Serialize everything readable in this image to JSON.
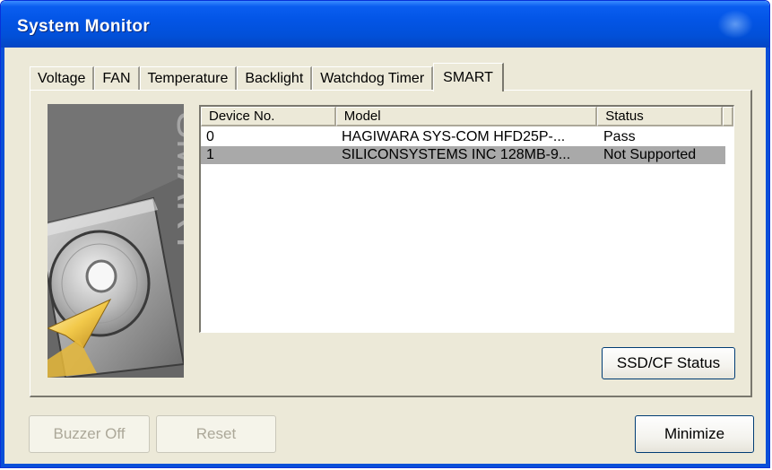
{
  "window": {
    "title": "System Monitor"
  },
  "tabs": [
    {
      "label": "Voltage",
      "active": false
    },
    {
      "label": "FAN",
      "active": false
    },
    {
      "label": "Temperature",
      "active": false
    },
    {
      "label": "Backlight",
      "active": false
    },
    {
      "label": "Watchdog Timer",
      "active": false
    },
    {
      "label": "SMART",
      "active": true
    }
  ],
  "smart_panel": {
    "image_text": "SMART",
    "columns": [
      "Device No.",
      "Model",
      "Status"
    ],
    "rows": [
      {
        "device_no": "0",
        "model": "HAGIWARA SYS-COM HFD25P-...",
        "status": "Pass",
        "selected": false
      },
      {
        "device_no": "1",
        "model": "SILICONSYSTEMS INC 128MB-9...",
        "status": "Not Supported",
        "selected": true
      }
    ],
    "ssd_cf_status_label": "SSD/CF Status"
  },
  "footer": {
    "buzzer_off_label": "Buzzer Off",
    "reset_label": "Reset",
    "minimize_label": "Minimize"
  },
  "colors": {
    "title_bar": "#0355e6",
    "selected_row": "#a9a9a9",
    "window_bg": "#ece9d8"
  }
}
